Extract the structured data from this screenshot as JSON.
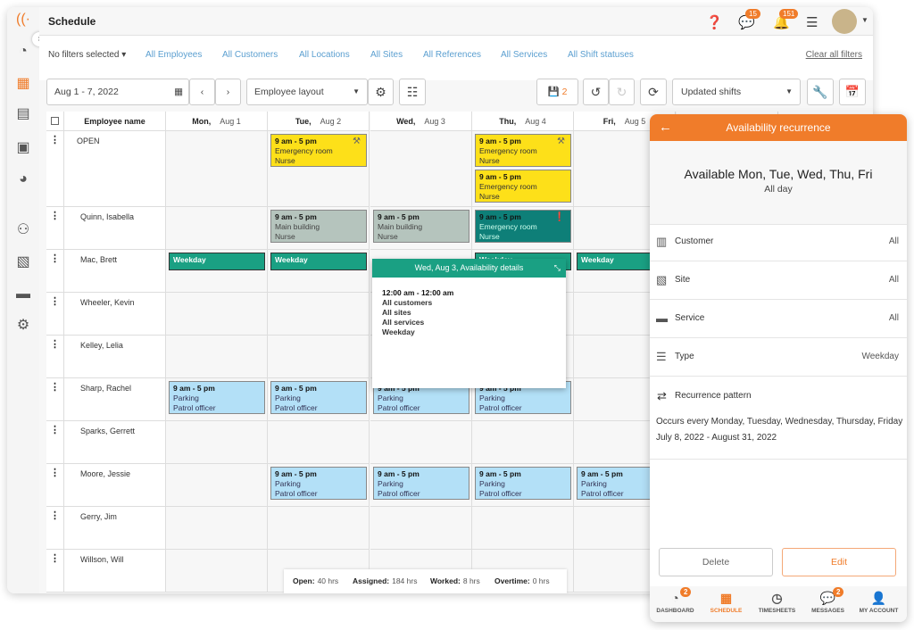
{
  "app": {
    "title": "Schedule",
    "notifications": {
      "messages": "15",
      "alerts": "151"
    }
  },
  "colors": {
    "accent": "#f07c2a",
    "link": "#5b9fd0",
    "yellow": "#fde019",
    "gray": "#b5c4bd",
    "teal": "#0e7f78",
    "green": "#1aa083",
    "blue": "#b3e0f7"
  },
  "filters": {
    "selected": "No filters selected",
    "items": [
      "All Employees",
      "All Customers",
      "All Locations",
      "All Sites",
      "All References",
      "All Services",
      "All Shift statuses"
    ],
    "clear": "Clear all filters"
  },
  "toolbar": {
    "date_range": "Aug 1 - 7, 2022",
    "layout": "Employee layout",
    "unsaved_count": "2",
    "view": "Updated shifts"
  },
  "grid": {
    "name_header": "Employee name",
    "days": [
      {
        "d": "Mon,",
        "date": "Aug 1"
      },
      {
        "d": "Tue,",
        "date": "Aug 2"
      },
      {
        "d": "Wed,",
        "date": "Aug 3"
      },
      {
        "d": "Thu,",
        "date": "Aug 4"
      },
      {
        "d": "Fri,",
        "date": "Aug 5"
      }
    ],
    "employees": [
      "OPEN",
      "Quinn, Isabella",
      "Mac, Brett",
      "Wheeler, Kevin",
      "Kelley, Lelia",
      "Sharp, Rachel",
      "Sparks, Gerrett",
      "Moore, Jessie",
      "Gerry, Jim",
      "Willson, Will"
    ],
    "shifts": [
      {
        "row": 0,
        "day": 1,
        "time": "9 am - 5 pm",
        "site": "Emergency room",
        "role": "Nurse",
        "style": "yellow",
        "icon": "hammer-icon"
      },
      {
        "row": 0,
        "day": 3,
        "time": "9 am - 5 pm",
        "site": "Emergency room",
        "role": "Nurse",
        "style": "yellow",
        "icon": "hammer-icon"
      },
      {
        "row": 0,
        "day": 3,
        "slot": 1,
        "time": "9 am - 5 pm",
        "site": "Emergency room",
        "role": "Nurse",
        "style": "yellow"
      },
      {
        "row": 1,
        "day": 1,
        "time": "9 am - 5 pm",
        "site": "Main building",
        "role": "Nurse",
        "style": "gray"
      },
      {
        "row": 1,
        "day": 2,
        "time": "9 am - 5 pm",
        "site": "Main building",
        "role": "Nurse",
        "style": "gray"
      },
      {
        "row": 1,
        "day": 3,
        "time": "9 am - 5 pm",
        "site": "Emergency room",
        "role": "Nurse",
        "style": "teal",
        "icon": "alert-icon"
      },
      {
        "row": 5,
        "day": 0,
        "time": "9 am - 5 pm",
        "site": "Parking",
        "role": "Patrol officer",
        "style": "blue"
      },
      {
        "row": 5,
        "day": 1,
        "time": "9 am - 5 pm",
        "site": "Parking",
        "role": "Patrol officer",
        "style": "blue"
      },
      {
        "row": 5,
        "day": 2,
        "time": "9 am - 5 pm",
        "site": "Parking",
        "role": "Patrol officer",
        "style": "blue"
      },
      {
        "row": 5,
        "day": 3,
        "time": "9 am - 5 pm",
        "site": "Parking",
        "role": "Patrol officer",
        "style": "blue"
      },
      {
        "row": 7,
        "day": 1,
        "time": "9 am - 5 pm",
        "site": "Parking",
        "role": "Patrol officer",
        "style": "blue"
      },
      {
        "row": 7,
        "day": 2,
        "time": "9 am - 5 pm",
        "site": "Parking",
        "role": "Patrol officer",
        "style": "blue"
      },
      {
        "row": 7,
        "day": 3,
        "time": "9 am - 5 pm",
        "site": "Parking",
        "role": "Patrol officer",
        "style": "blue"
      },
      {
        "row": 7,
        "day": 4,
        "time": "9 am - 5 pm",
        "site": "Parking",
        "role": "Patrol officer",
        "style": "blue"
      }
    ],
    "availability": {
      "row": 2,
      "days": [
        0,
        1,
        3,
        4
      ],
      "label": "Weekday"
    }
  },
  "popup": {
    "title": "Wed, Aug 3, Availability details",
    "lines": [
      "12:00 am - 12:00 am",
      "All customers",
      "All sites",
      "All services",
      "Weekday"
    ]
  },
  "summary": [
    {
      "k": "Open:",
      "v": "40 hrs"
    },
    {
      "k": "Assigned:",
      "v": "184 hrs"
    },
    {
      "k": "Worked:",
      "v": "8 hrs"
    },
    {
      "k": "Overtime:",
      "v": "0 hrs"
    }
  ],
  "panel": {
    "title": "Availability recurrence",
    "heading": "Available Mon, Tue, Wed, Thu, Fri",
    "subheading": "All day",
    "rows": [
      {
        "label": "Customer",
        "value": "All",
        "icon": "building-icon"
      },
      {
        "label": "Site",
        "value": "All",
        "icon": "map-icon"
      },
      {
        "label": "Service",
        "value": "All",
        "icon": "briefcase-icon"
      },
      {
        "label": "Type",
        "value": "Weekday",
        "icon": "list-icon"
      }
    ],
    "recurrence_label": "Recurrence pattern",
    "recurrence_text": "Occurs every Monday, Tuesday, Wednesday, Thursday, Friday",
    "recurrence_dates": "July 8, 2022 - August 31, 2022",
    "delete": "Delete",
    "edit": "Edit",
    "nav": [
      {
        "label": "DASHBOARD",
        "badge": "2"
      },
      {
        "label": "SCHEDULE",
        "active": true
      },
      {
        "label": "TIMESHEETS"
      },
      {
        "label": "MESSAGES",
        "badge": "2"
      },
      {
        "label": "MY ACCOUNT"
      }
    ]
  }
}
